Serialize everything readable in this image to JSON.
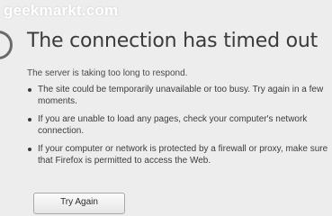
{
  "watermark": "geekmarkt.com",
  "error": {
    "title": "The connection has timed out",
    "summary": "The server is taking too long to respond.",
    "suggestions": [
      "The site could be temporarily unavailable or too busy. Try again in a few moments.",
      "If you are unable to load any pages, check your computer's network connection.",
      "If your computer or network is protected by a firewall or proxy, make sure that Firefox is permitted to access the Web."
    ],
    "try_again_label": "Try Again"
  },
  "colors": {
    "background": "#ededed",
    "title_text": "#3a3a3a",
    "icon_ring": "#6a6a6a"
  },
  "icons": {
    "status": "error-circle-icon"
  }
}
